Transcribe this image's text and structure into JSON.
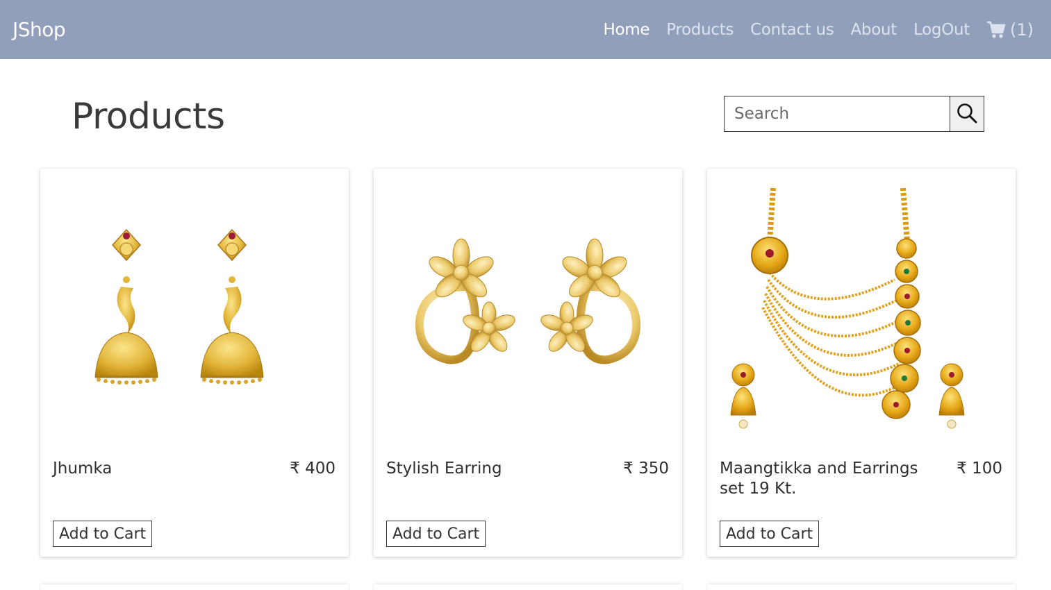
{
  "nav": {
    "brand": "JShop",
    "links": [
      "Home",
      "Products",
      "Contact us",
      "About",
      "LogOut"
    ],
    "cart_count": "(1)",
    "cart_icon": "shopping-cart-icon"
  },
  "main": {
    "title": "Products",
    "search": {
      "placeholder": "Search",
      "value": "",
      "icon": "search-icon"
    }
  },
  "products": [
    {
      "name": "Jhumka",
      "price": "₹ 400",
      "button": "Add to Cart"
    },
    {
      "name": "Stylish Earring",
      "price": "₹ 350",
      "button": "Add to Cart"
    },
    {
      "name": "Maangtikka and Earrings set 19 Kt.",
      "price": "₹ 100",
      "button": "Add to Cart"
    }
  ],
  "colors": {
    "navbar": "#919fbb",
    "gold": "#e2b53b",
    "gold_dark": "#b8860b"
  }
}
